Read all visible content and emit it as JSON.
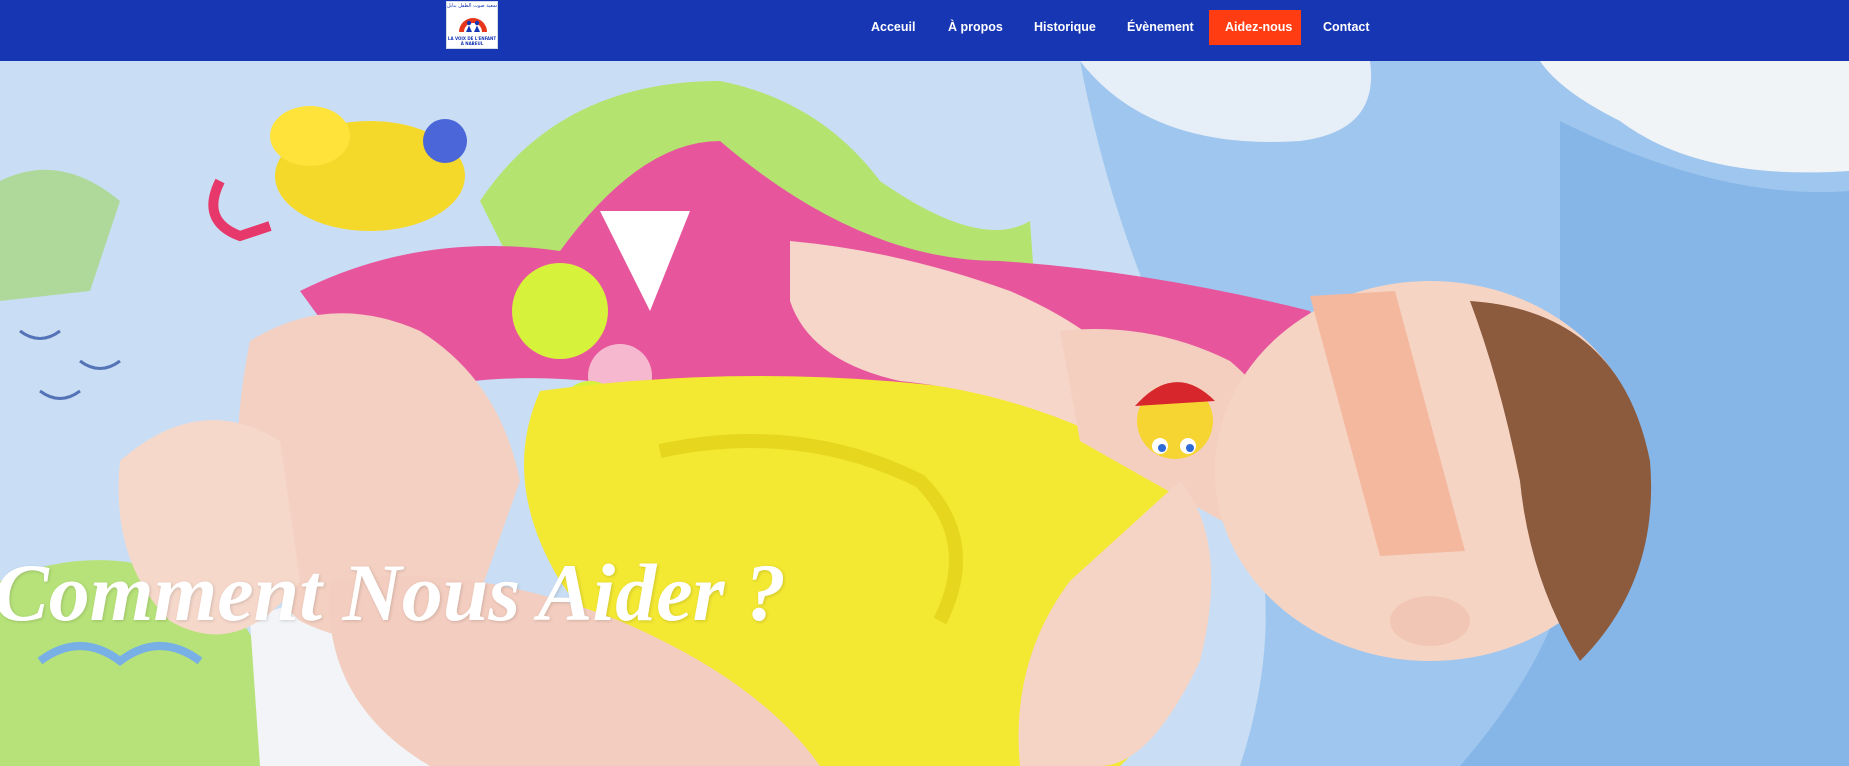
{
  "header": {
    "logo": {
      "arabic_text": "جمعية صوت الطفل بنابل",
      "caption": "La voix de l'enfant à Nabeul",
      "icon": "rainbow-family-logo"
    },
    "nav": [
      {
        "label": "Acceuil"
      },
      {
        "label": "À propos"
      },
      {
        "label": "Historique"
      },
      {
        "label": "Évènement"
      },
      {
        "label": "Aidez-nous"
      },
      {
        "label": "Contact"
      }
    ]
  },
  "hero": {
    "title": "Comment Nous Aider ?",
    "background": "photo-baby-on-playmat"
  },
  "colors": {
    "header_bg": "#1736b4",
    "cta_bg": "#ff3c12",
    "text_light": "#ffffff"
  }
}
